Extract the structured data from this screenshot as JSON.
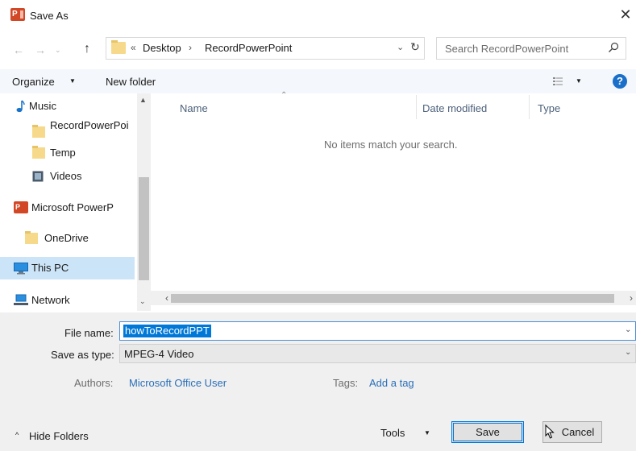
{
  "window": {
    "title": "Save As",
    "app_icon": "P"
  },
  "navigation": {
    "back": "←",
    "forward": "→",
    "history": "⌄",
    "up": "↑"
  },
  "address": {
    "chevron": "«",
    "crumb_root": "Desktop",
    "separator": "›",
    "crumb_current": "RecordPowerPoint"
  },
  "search": {
    "placeholder": "Search RecordPowerPoint"
  },
  "toolbar": {
    "organize": "Organize",
    "new_folder": "New folder"
  },
  "sidebar": {
    "items": [
      {
        "label": "Music",
        "icon": "music-note-icon"
      },
      {
        "label": "RecordPowerPoi",
        "icon": "folder-icon"
      },
      {
        "label": "Temp",
        "icon": "folder-icon"
      },
      {
        "label": "Videos",
        "icon": "video-icon"
      },
      {
        "label": "Microsoft PowerP",
        "icon": "powerpoint-icon"
      },
      {
        "label": "OneDrive",
        "icon": "folder-icon"
      },
      {
        "label": "This PC",
        "icon": "computer-icon",
        "selected": true
      },
      {
        "label": "Network",
        "icon": "network-icon"
      }
    ]
  },
  "file_list": {
    "columns": [
      "Name",
      "Date modified",
      "Type"
    ],
    "empty_message": "No items match your search."
  },
  "form": {
    "file_name_label": "File name:",
    "file_name_value": "howToRecordPPT",
    "save_type_label": "Save as type:",
    "save_type_value": "MPEG-4 Video",
    "authors_label": "Authors:",
    "authors_value": "Microsoft Office User",
    "tags_label": "Tags:",
    "tags_value": "Add a tag"
  },
  "footer": {
    "hide_folders": "Hide Folders",
    "tools": "Tools",
    "save": "Save",
    "cancel": "Cancel"
  },
  "colors": {
    "accent": "#0078d7",
    "selection": "#cce4f7",
    "link": "#2a6fb8"
  }
}
